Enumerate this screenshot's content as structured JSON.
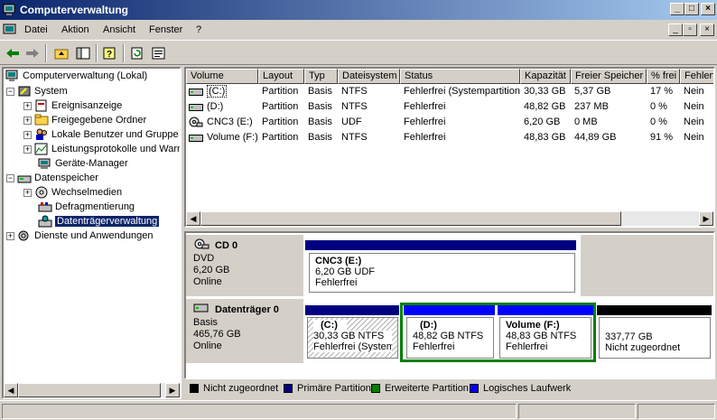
{
  "window": {
    "title": "Computerverwaltung"
  },
  "menu": {
    "items": [
      "Datei",
      "Aktion",
      "Ansicht",
      "Fenster",
      "?"
    ]
  },
  "titlebuttons": {
    "min": "_",
    "max": "□",
    "close": "×"
  },
  "tree": {
    "root": "Computerverwaltung (Lokal)",
    "system": "System",
    "ereignis": "Ereignisanzeige",
    "freigaben": "Freigegebene Ordner",
    "benutzer": "Lokale Benutzer und Gruppe",
    "leistung": "Leistungsprotokolle und Warn",
    "geraete": "Geräte-Manager",
    "datenspeicher": "Datenspeicher",
    "wechsel": "Wechselmedien",
    "defrag": "Defragmentierung",
    "datentraeger": "Datenträgerverwaltung",
    "dienste": "Dienste und Anwendungen"
  },
  "volumes": {
    "headers": [
      "Volume",
      "Layout",
      "Typ",
      "Dateisystem",
      "Status",
      "Kapazität",
      "Freier Speicher",
      "% frei",
      "Fehlerto"
    ],
    "rows": [
      {
        "name": "(C:)",
        "layout": "Partition",
        "typ": "Basis",
        "fs": "NTFS",
        "status": "Fehlerfrei (Systempartition)",
        "kap": "30,33 GB",
        "frei": "5,37 GB",
        "pct": "17 %",
        "fehler": "Nein"
      },
      {
        "name": "(D:)",
        "layout": "Partition",
        "typ": "Basis",
        "fs": "NTFS",
        "status": "Fehlerfrei",
        "kap": "48,82 GB",
        "frei": "237 MB",
        "pct": "0 %",
        "fehler": "Nein"
      },
      {
        "name": "CNC3 (E:)",
        "layout": "Partition",
        "typ": "Basis",
        "fs": "UDF",
        "status": "Fehlerfrei",
        "kap": "6,20 GB",
        "frei": "0 MB",
        "pct": "0 %",
        "fehler": "Nein"
      },
      {
        "name": "Volume (F:)",
        "layout": "Partition",
        "typ": "Basis",
        "fs": "NTFS",
        "status": "Fehlerfrei",
        "kap": "48,83 GB",
        "frei": "44,89 GB",
        "pct": "91 %",
        "fehler": "Nein"
      }
    ]
  },
  "disks": {
    "cd": {
      "name": "CD 0",
      "type": "DVD",
      "size": "6,20 GB",
      "state": "Online",
      "part": {
        "label": "CNC3  (E:)",
        "size": "6,20 GB UDF",
        "status": "Fehlerfrei"
      }
    },
    "disk0": {
      "name": "Datenträger 0",
      "type": "Basis",
      "size": "465,76 GB",
      "state": "Online",
      "parts": [
        {
          "label": "(C:)",
          "size": "30,33 GB NTFS",
          "status": "Fehlerfrei (Systemp"
        },
        {
          "label": "(D:)",
          "size": "48,82 GB NTFS",
          "status": "Fehlerfrei"
        },
        {
          "label": "Volume  (F:)",
          "size": "48,83 GB NTFS",
          "status": "Fehlerfrei"
        },
        {
          "label": "",
          "size": "337,77 GB",
          "status": "Nicht zugeordnet"
        }
      ]
    }
  },
  "legend": [
    {
      "label": "Nicht zugeordnet",
      "color": "#000000"
    },
    {
      "label": "Primäre Partition",
      "color": "#000080"
    },
    {
      "label": "Erweiterte Partition",
      "color": "#008000"
    },
    {
      "label": "Logisches Laufwerk",
      "color": "#0000ff"
    }
  ]
}
